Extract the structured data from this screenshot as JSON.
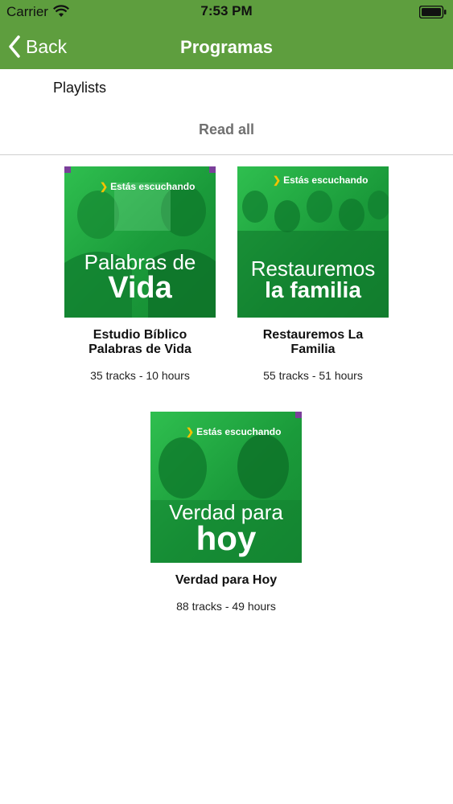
{
  "status_bar": {
    "carrier": "Carrier",
    "time": "7:53 PM"
  },
  "nav": {
    "back_label": "Back",
    "title": "Programas"
  },
  "section": {
    "label": "Playlists",
    "read_all": "Read all"
  },
  "colors": {
    "header": "#5e9e3e",
    "cover_green": "#1f9f3d",
    "accent_yellow": "#f5c200"
  },
  "programs": [
    {
      "cover_tag": "Estás escuchando",
      "cover_line1": "Palabras de",
      "cover_line2": "Vida",
      "title_line1": "Estudio Bíblico",
      "title_line2": "Palabras de Vida",
      "meta": "35 tracks - 10 hours"
    },
    {
      "cover_tag": "Estás escuchando",
      "cover_line1": "Restauremos",
      "cover_line2": "la familia",
      "title_line1": "Restauremos La",
      "title_line2": "Familia",
      "meta": "55 tracks - 51 hours"
    },
    {
      "cover_tag": "Estás escuchando",
      "cover_line1": "Verdad para",
      "cover_line2": "hoy",
      "title_line1": "Verdad para Hoy",
      "title_line2": "",
      "meta": "88 tracks - 49 hours"
    }
  ]
}
